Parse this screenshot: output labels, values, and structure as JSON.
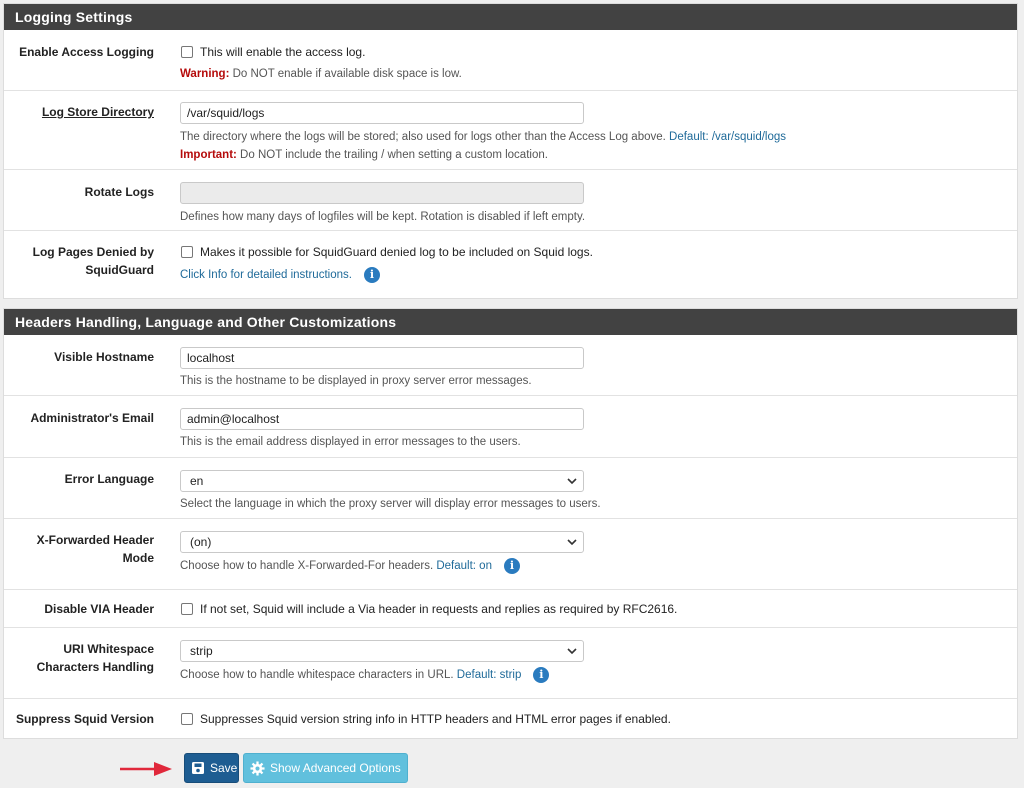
{
  "logging": {
    "heading": "Logging Settings",
    "access_logging": {
      "label": "Enable Access Logging",
      "checkbox_text": "This will enable the access log.",
      "warning_label": "Warning:",
      "warning_text": " Do NOT enable if available disk space is low."
    },
    "log_store": {
      "label": "Log Store Directory",
      "value": "/var/squid/logs",
      "help": "The directory where the logs will be stored; also used for logs other than the Access Log above. ",
      "help_default": "Default: /var/squid/logs",
      "important_label": "Important:",
      "important_text": " Do NOT include the trailing / when setting a custom location."
    },
    "rotate": {
      "label": "Rotate Logs",
      "value": "",
      "help": "Defines how many days of logfiles will be kept. Rotation is disabled if left empty."
    },
    "denied": {
      "label": "Log Pages Denied by SquidGuard",
      "checkbox_text": "Makes it possible for SquidGuard denied log to be included on Squid logs.",
      "link": "Click Info for detailed instructions."
    }
  },
  "headers": {
    "heading": "Headers Handling, Language and Other Customizations",
    "hostname": {
      "label": "Visible Hostname",
      "value": "localhost",
      "help": "This is the hostname to be displayed in proxy server error messages."
    },
    "email": {
      "label": "Administrator's Email",
      "value": "admin@localhost",
      "help": "This is the email address displayed in error messages to the users."
    },
    "language": {
      "label": "Error Language",
      "value": "en",
      "help": "Select the language in which the proxy server will display error messages to users."
    },
    "xff": {
      "label": "X-Forwarded Header Mode",
      "value": "(on)",
      "help": "Choose how to handle X-Forwarded-For headers. ",
      "help_default": "Default: on"
    },
    "via": {
      "label": "Disable VIA Header",
      "checkbox_text": "If not set, Squid will include a Via header in requests and replies as required by RFC2616."
    },
    "uri": {
      "label": "URI Whitespace Characters Handling",
      "value": "strip",
      "help": "Choose how to handle whitespace characters in URL. ",
      "help_default": "Default: strip"
    },
    "suppress": {
      "label": "Suppress Squid Version",
      "checkbox_text": "Suppresses Squid version string info in HTTP headers and HTML error pages if enabled."
    }
  },
  "actions": {
    "save_label": "Save",
    "advanced_label": "Show Advanced Options"
  },
  "colors": {
    "heading_bg": "#424242",
    "save_bg": "#1e5d92",
    "advanced_bg": "#61c0dd",
    "warning": "#b50b0b",
    "link": "#1f6a99",
    "info_icon": "#2a7bbf",
    "arrow": "#e0283b"
  }
}
